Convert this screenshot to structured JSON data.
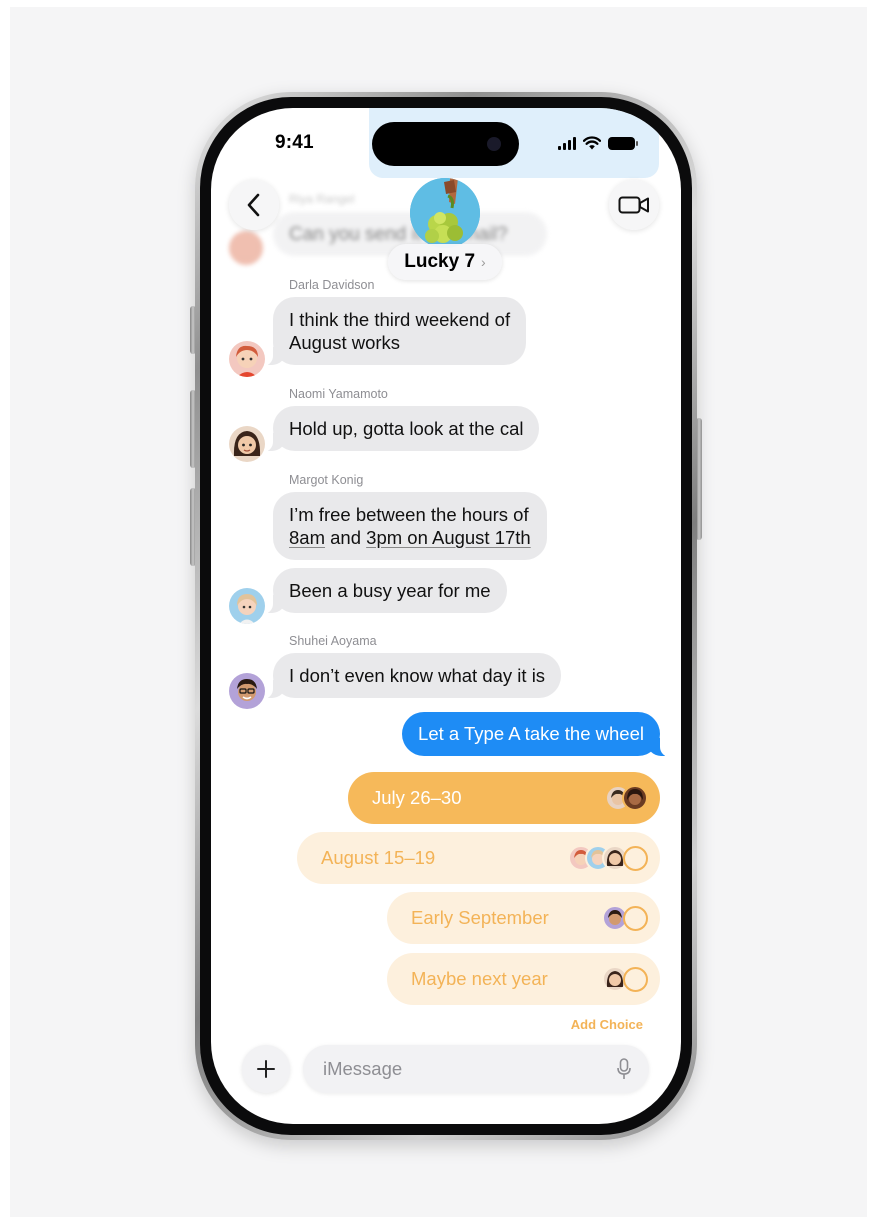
{
  "status_bar": {
    "time": "9:41"
  },
  "header": {
    "group_name": "Lucky 7",
    "chevron": "›",
    "back_icon": "chevron-left-icon",
    "video_icon": "video-camera-icon"
  },
  "blurred": {
    "sender": "Riya Rangel",
    "message": "Can you send it by email?"
  },
  "messages": [
    {
      "sender": "Darla Davidson",
      "line1": "I think the third weekend of",
      "line2": "August works"
    },
    {
      "sender": "Naomi Yamamoto",
      "text": "Hold up, gotta look at the cal"
    },
    {
      "sender": "Margot Konig",
      "line1": "I’m free between the hours of",
      "line2_part1": "8am",
      "line2_part2": " and ",
      "line2_part3": "3pm on August 17th"
    },
    {
      "text": "Been a busy year for me"
    },
    {
      "sender": "Shuhei Aoyama",
      "text": "I don’t even know what day it is"
    }
  ],
  "outgoing": {
    "text": "Let a Type A take the wheel"
  },
  "poll": {
    "options": [
      {
        "label": "July 26–30",
        "selected": true,
        "votes": 2
      },
      {
        "label": "August 15–19",
        "selected": false,
        "votes": 3
      },
      {
        "label": "Early September",
        "selected": false,
        "votes": 1
      },
      {
        "label": "Maybe next year",
        "selected": false,
        "votes": 1
      }
    ],
    "add_choice": "Add Choice"
  },
  "input": {
    "placeholder": "iMessage"
  },
  "colors": {
    "outgoing_blue": "#1e8cf5",
    "poll_selected": "#f6b95a",
    "poll_option_bg": "#fdf0dd",
    "poll_text": "#f3b357",
    "incoming_gray": "#e9e9eb"
  }
}
